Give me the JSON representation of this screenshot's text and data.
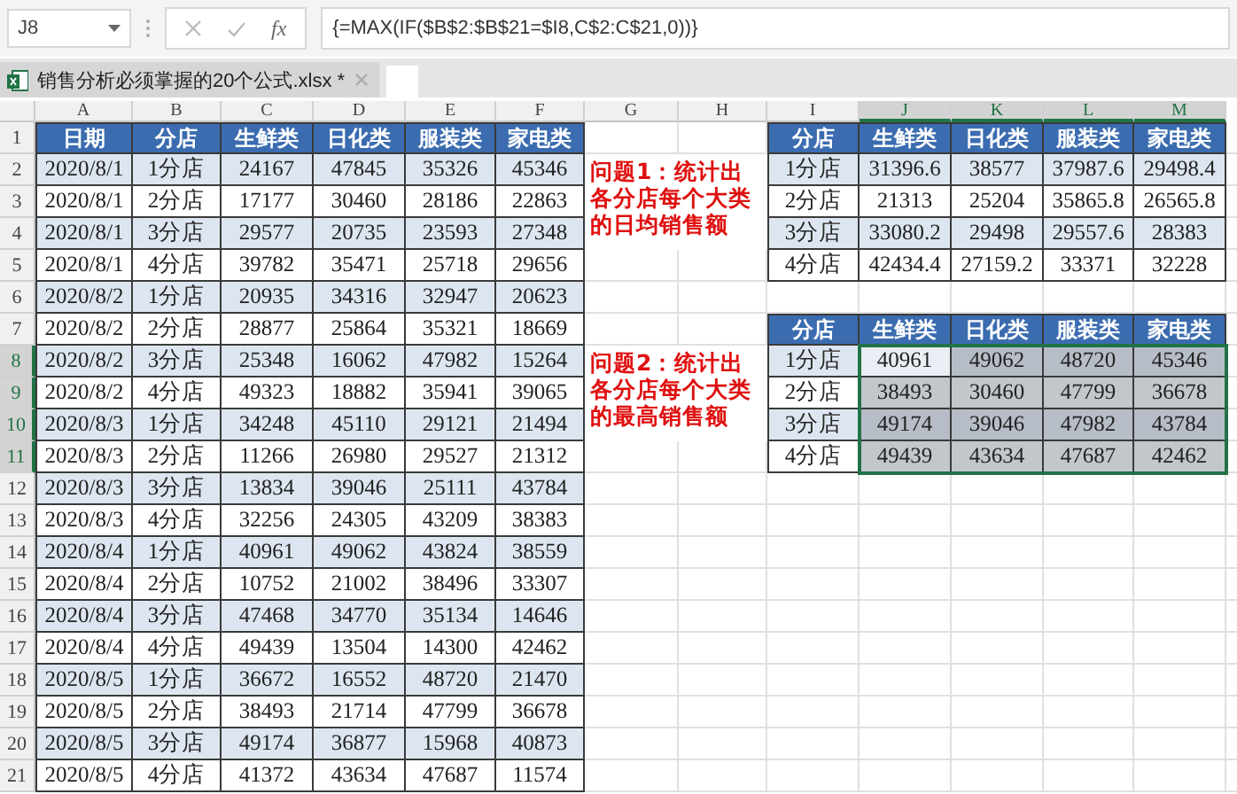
{
  "name_box": "J8",
  "function_label": "fx",
  "formula": "{=MAX(IF($B$2:$B$21=$I8,C$2:C$21,0))}",
  "file_tab": {
    "title": "销售分析必须掌握的20个公式.xlsx *"
  },
  "columns": [
    {
      "label": "A",
      "selected": false
    },
    {
      "label": "B",
      "selected": false
    },
    {
      "label": "C",
      "selected": false
    },
    {
      "label": "D",
      "selected": false
    },
    {
      "label": "E",
      "selected": false
    },
    {
      "label": "F",
      "selected": false
    },
    {
      "label": "G",
      "selected": false
    },
    {
      "label": "H",
      "selected": false
    },
    {
      "label": "I",
      "selected": false
    },
    {
      "label": "J",
      "selected": true
    },
    {
      "label": "K",
      "selected": true
    },
    {
      "label": "L",
      "selected": true
    },
    {
      "label": "M",
      "selected": true
    }
  ],
  "rows": [
    {
      "label": "1",
      "selected": false
    },
    {
      "label": "2",
      "selected": false
    },
    {
      "label": "3",
      "selected": false
    },
    {
      "label": "4",
      "selected": false
    },
    {
      "label": "5",
      "selected": false
    },
    {
      "label": "6",
      "selected": false
    },
    {
      "label": "7",
      "selected": false
    },
    {
      "label": "8",
      "selected": true
    },
    {
      "label": "9",
      "selected": true
    },
    {
      "label": "10",
      "selected": true
    },
    {
      "label": "11",
      "selected": true
    },
    {
      "label": "12",
      "selected": false
    },
    {
      "label": "13",
      "selected": false
    },
    {
      "label": "14",
      "selected": false
    },
    {
      "label": "15",
      "selected": false
    },
    {
      "label": "16",
      "selected": false
    },
    {
      "label": "17",
      "selected": false
    },
    {
      "label": "18",
      "selected": false
    },
    {
      "label": "19",
      "selected": false
    },
    {
      "label": "20",
      "selected": false
    },
    {
      "label": "21",
      "selected": false
    }
  ],
  "data_table": {
    "headers": [
      "日期",
      "分店",
      "生鲜类",
      "日化类",
      "服装类",
      "家电类"
    ],
    "rows": [
      [
        "2020/8/1",
        "1分店",
        "24167",
        "47845",
        "35326",
        "45346"
      ],
      [
        "2020/8/1",
        "2分店",
        "17177",
        "30460",
        "28186",
        "22863"
      ],
      [
        "2020/8/1",
        "3分店",
        "29577",
        "20735",
        "23593",
        "27348"
      ],
      [
        "2020/8/1",
        "4分店",
        "39782",
        "35471",
        "25718",
        "29656"
      ],
      [
        "2020/8/2",
        "1分店",
        "20935",
        "34316",
        "32947",
        "20623"
      ],
      [
        "2020/8/2",
        "2分店",
        "28877",
        "25864",
        "35321",
        "18669"
      ],
      [
        "2020/8/2",
        "3分店",
        "25348",
        "16062",
        "47982",
        "15264"
      ],
      [
        "2020/8/2",
        "4分店",
        "49323",
        "18882",
        "35941",
        "39065"
      ],
      [
        "2020/8/3",
        "1分店",
        "34248",
        "45110",
        "29121",
        "21494"
      ],
      [
        "2020/8/3",
        "2分店",
        "11266",
        "26980",
        "29527",
        "21312"
      ],
      [
        "2020/8/3",
        "3分店",
        "13834",
        "39046",
        "25111",
        "43784"
      ],
      [
        "2020/8/3",
        "4分店",
        "32256",
        "24305",
        "43209",
        "38383"
      ],
      [
        "2020/8/4",
        "1分店",
        "40961",
        "49062",
        "43824",
        "38559"
      ],
      [
        "2020/8/4",
        "2分店",
        "10752",
        "21002",
        "38496",
        "33307"
      ],
      [
        "2020/8/4",
        "3分店",
        "47468",
        "34770",
        "35134",
        "14646"
      ],
      [
        "2020/8/4",
        "4分店",
        "49439",
        "13504",
        "14300",
        "42462"
      ],
      [
        "2020/8/5",
        "1分店",
        "36672",
        "16552",
        "48720",
        "21470"
      ],
      [
        "2020/8/5",
        "2分店",
        "38493",
        "21714",
        "47799",
        "36678"
      ],
      [
        "2020/8/5",
        "3分店",
        "49174",
        "36877",
        "15968",
        "40873"
      ],
      [
        "2020/8/5",
        "4分店",
        "41372",
        "43634",
        "47687",
        "11574"
      ]
    ]
  },
  "notes": [
    "问题1：统计出各分店每个大类的日均销售额",
    "问题2：统计出各分店每个大类的最高销售额"
  ],
  "avg_table": {
    "headers": [
      "分店",
      "生鲜类",
      "日化类",
      "服装类",
      "家电类"
    ],
    "rows": [
      [
        "1分店",
        "31396.6",
        "38577",
        "37987.6",
        "29498.4"
      ],
      [
        "2分店",
        "21313",
        "25204",
        "35865.8",
        "26565.8"
      ],
      [
        "3分店",
        "33080.2",
        "29498",
        "29557.6",
        "28383"
      ],
      [
        "4分店",
        "42434.4",
        "27159.2",
        "33371",
        "32228"
      ]
    ]
  },
  "max_table": {
    "headers": [
      "分店",
      "生鲜类",
      "日化类",
      "服装类",
      "家电类"
    ],
    "rows": [
      {
        "store": "1分店",
        "cells": [
          {
            "text": "40961",
            "selected": true,
            "active": true
          },
          {
            "text": "49062",
            "selected": true,
            "active": false
          },
          {
            "text": "48720",
            "selected": true,
            "active": false
          },
          {
            "text": "45346",
            "selected": true,
            "active": false
          }
        ]
      },
      {
        "store": "2分店",
        "cells": [
          {
            "text": "38493",
            "selected": true,
            "active": false
          },
          {
            "text": "30460",
            "selected": true,
            "active": false
          },
          {
            "text": "47799",
            "selected": true,
            "active": false
          },
          {
            "text": "36678",
            "selected": true,
            "active": false
          }
        ]
      },
      {
        "store": "3分店",
        "cells": [
          {
            "text": "49174",
            "selected": true,
            "active": false
          },
          {
            "text": "39046",
            "selected": true,
            "active": false
          },
          {
            "text": "47982",
            "selected": true,
            "active": false
          },
          {
            "text": "43784",
            "selected": true,
            "active": false
          }
        ]
      },
      {
        "store": "4分店",
        "cells": [
          {
            "text": "49439",
            "selected": true,
            "active": false
          },
          {
            "text": "43634",
            "selected": true,
            "active": false
          },
          {
            "text": "47687",
            "selected": true,
            "active": false
          },
          {
            "text": "42462",
            "selected": true,
            "active": false
          }
        ]
      }
    ]
  }
}
